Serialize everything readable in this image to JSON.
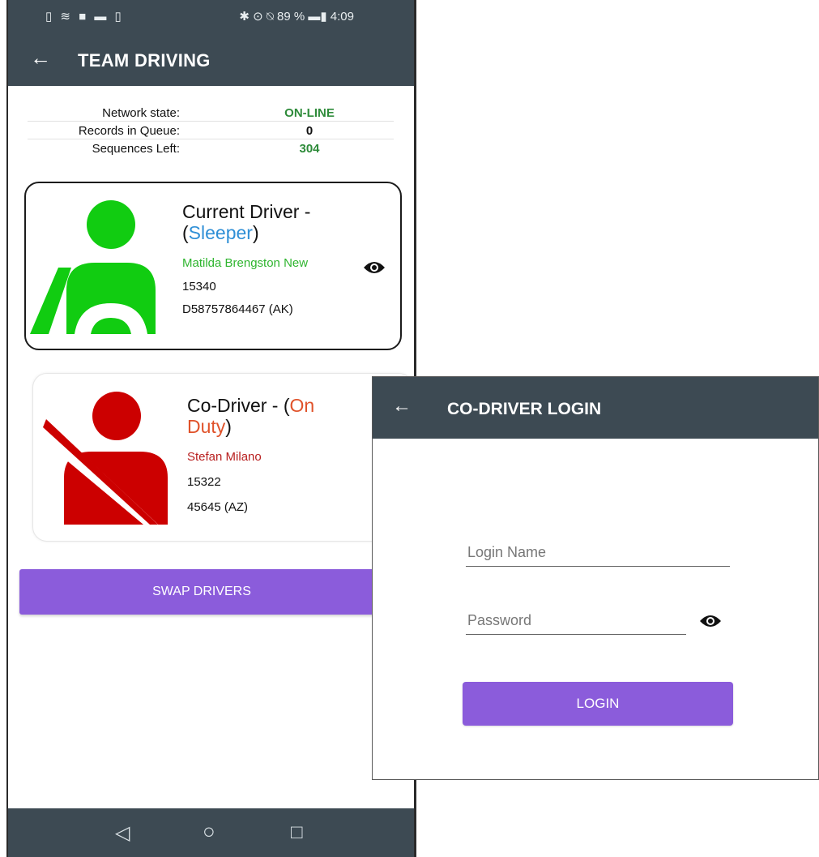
{
  "status_bar": {
    "left_icons": "▯ ≋ ■ ▬ ▯",
    "right_icons": "✱ ⊙ ⍉ 89 % ▬▮ 4:09"
  },
  "app_bar": {
    "title": "TEAM DRIVING",
    "back_icon": "arrow-left-icon"
  },
  "info": [
    {
      "label": "Network state:",
      "value": "ON-LINE",
      "color": "#2e8b3a"
    },
    {
      "label": "Records in Queue:",
      "value": "0",
      "color": "#111111"
    },
    {
      "label": "Sequences Left:",
      "value": "304",
      "color": "#2e8b3a"
    }
  ],
  "current_driver": {
    "heading_prefix": "Current Driver -",
    "status_open": "(",
    "status": "Sleeper",
    "status_close": ")",
    "status_color": "#2f8fd6",
    "name": "Matilda Brengston New",
    "name_color": "#2fb52f",
    "id": "15340",
    "license": "D58757864467 (AK)",
    "icon": "driver-at-wheel-icon",
    "icon_color": "#11cc11"
  },
  "co_driver": {
    "heading_prefix": "Co-Driver - (",
    "status_line1": "On",
    "status_line2": "Duty",
    "status_close": ")",
    "status_color": "#e0522a",
    "name": "Stefan Milano",
    "name_color": "#b81f1f",
    "id": "15322",
    "license": "45645 (AZ)",
    "icon": "seatbelt-passenger-icon",
    "icon_color": "#cc0000"
  },
  "swap_button": "SWAP DRIVERS",
  "nav": {
    "back": "◁",
    "home": "○",
    "recents": "□"
  },
  "login": {
    "title": "CO-DRIVER LOGIN",
    "login_name_placeholder": "Login Name",
    "password_placeholder": "Password",
    "button": "LOGIN"
  },
  "colors": {
    "app_bar": "#3d4a53",
    "accent_button": "#8b5cdb"
  }
}
